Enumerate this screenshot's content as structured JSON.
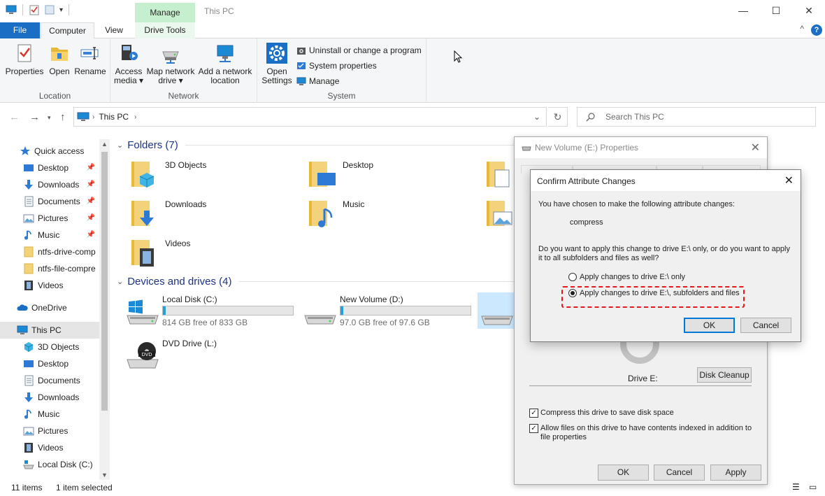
{
  "window": {
    "title": "This PC",
    "context_tab": "Manage",
    "minimize": "—",
    "maximize": "☐",
    "close": "✕"
  },
  "ribbon_tabs": {
    "file": "File",
    "computer": "Computer",
    "view": "View",
    "drive_tools": "Drive Tools",
    "help": "?",
    "collapse": "^"
  },
  "ribbon": {
    "location": {
      "label": "Location",
      "properties": "Properties",
      "open": "Open",
      "rename": "Rename"
    },
    "network": {
      "label": "Network",
      "access_media_1": "Access",
      "access_media_2": "media ▾",
      "map_drive_1": "Map network",
      "map_drive_2": "drive ▾",
      "add_location_1": "Add a network",
      "add_location_2": "location"
    },
    "system": {
      "label": "System",
      "open_settings_1": "Open",
      "open_settings_2": "Settings",
      "uninstall": "Uninstall or change a program",
      "system_properties": "System properties",
      "manage": "Manage"
    }
  },
  "address": {
    "crumb": "This PC",
    "search_placeholder": "Search This PC"
  },
  "nav": {
    "quick_access": "Quick access",
    "qa_items": [
      "Desktop",
      "Downloads",
      "Documents",
      "Pictures",
      "Music",
      "ntfs-drive-comp",
      "ntfs-file-compre",
      "Videos"
    ],
    "onedrive": "OneDrive",
    "this_pc": "This PC",
    "pc_items": [
      "3D Objects",
      "Desktop",
      "Documents",
      "Downloads",
      "Music",
      "Pictures",
      "Videos",
      "Local Disk (C:)"
    ]
  },
  "content": {
    "folders_header": "Folders (7)",
    "folders": [
      "3D Objects",
      "Desktop",
      "Downloads",
      "Music",
      "Videos"
    ],
    "devices_header": "Devices and drives (4)",
    "drives": [
      {
        "name": "Local Disk (C:)",
        "free": "814 GB free of 833 GB",
        "used_fraction": 0.023
      },
      {
        "name": "New Volume (D:)",
        "free": "97.0 GB free of 97.6 GB",
        "used_fraction": 0.006
      },
      {
        "name": "DVD Drive (L:)"
      }
    ]
  },
  "status": {
    "items": "11 items",
    "selected": "1 item selected"
  },
  "properties_dialog": {
    "title": "New Volume (E:) Properties",
    "drive_label": "Drive E:",
    "disk_cleanup": "Disk Cleanup",
    "compress": "Compress this drive to save disk space",
    "index_1": "Allow files on this drive to have contents indexed in addition to",
    "index_2": "file properties",
    "ok": "OK",
    "cancel": "Cancel",
    "apply": "Apply"
  },
  "confirm_dialog": {
    "title": "Confirm Attribute Changes",
    "intro": "You have chosen to make the following attribute changes:",
    "change": "compress",
    "question_1": "Do you want to apply this change to drive E:\\ only, or do you want to apply",
    "question_2": "it to all subfolders and files as well?",
    "option_1": "Apply changes to drive E:\\ only",
    "option_2": "Apply changes to drive E:\\, subfolders and files",
    "selected_option": 2,
    "ok": "OK",
    "cancel": "Cancel",
    "highlight_color": "#e8151a"
  },
  "colors": {
    "accent": "#1a6fc5",
    "drive_bar": "#26a0da",
    "manage_tab": "#c6efcf",
    "group_header": "#1e3287"
  }
}
